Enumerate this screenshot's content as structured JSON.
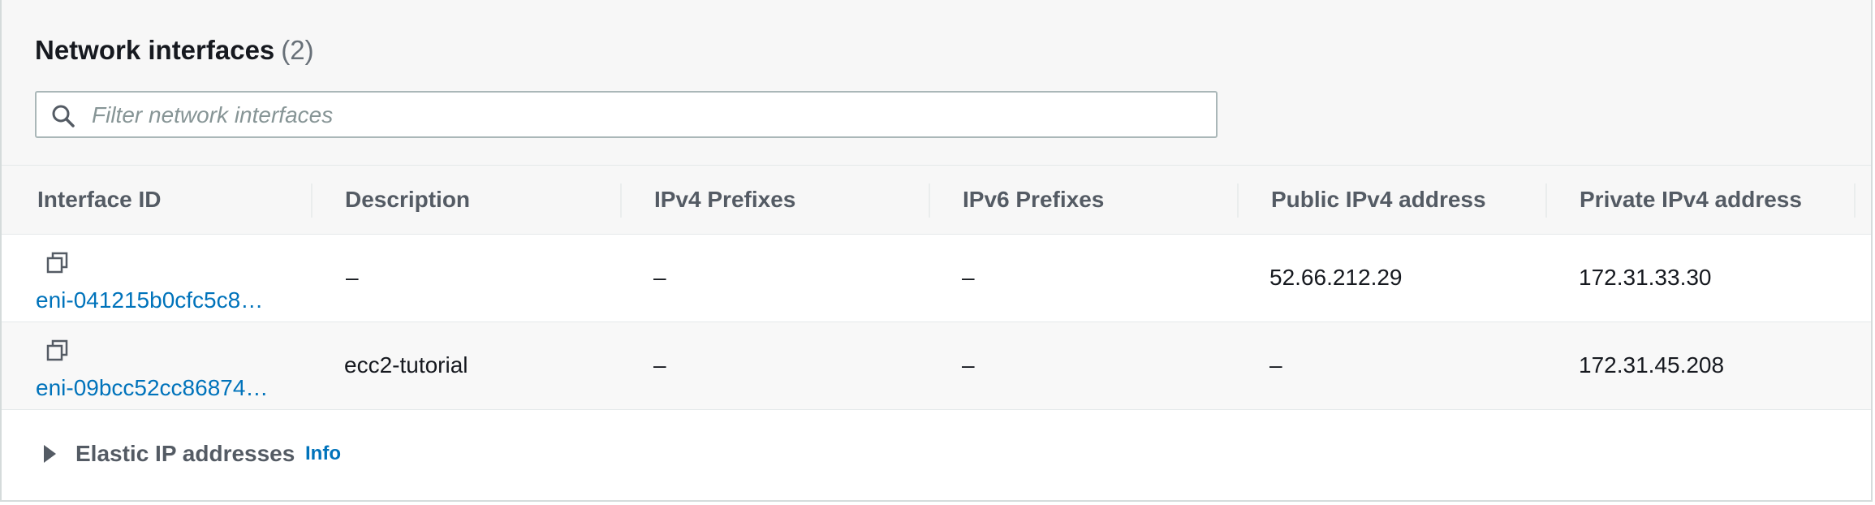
{
  "panel": {
    "title": "Network interfaces",
    "count": "(2)"
  },
  "filter": {
    "placeholder": "Filter network interfaces",
    "value": "",
    "icon": "search-icon"
  },
  "table": {
    "columns": [
      "Interface ID",
      "Description",
      "IPv4 Prefixes",
      "IPv6 Prefixes",
      "Public IPv4 address",
      "Private IPv4 address"
    ],
    "rows": [
      {
        "interface_id": "eni-041215b0cfc5c8…",
        "description": "–",
        "ipv4_prefixes": "–",
        "ipv6_prefixes": "–",
        "public_ipv4": "52.66.212.29",
        "private_ipv4": "172.31.33.30"
      },
      {
        "interface_id": "eni-09bcc52cc86874…",
        "description": "ecc2-tutorial",
        "ipv4_prefixes": "–",
        "ipv6_prefixes": "–",
        "public_ipv4": "–",
        "private_ipv4": "172.31.45.208"
      }
    ]
  },
  "elastic_ip": {
    "label": "Elastic IP addresses",
    "info": "Info",
    "expanded": false
  },
  "colors": {
    "link": "#0073bb",
    "header_bg": "#f7f7f7",
    "border": "#aab7b8"
  }
}
